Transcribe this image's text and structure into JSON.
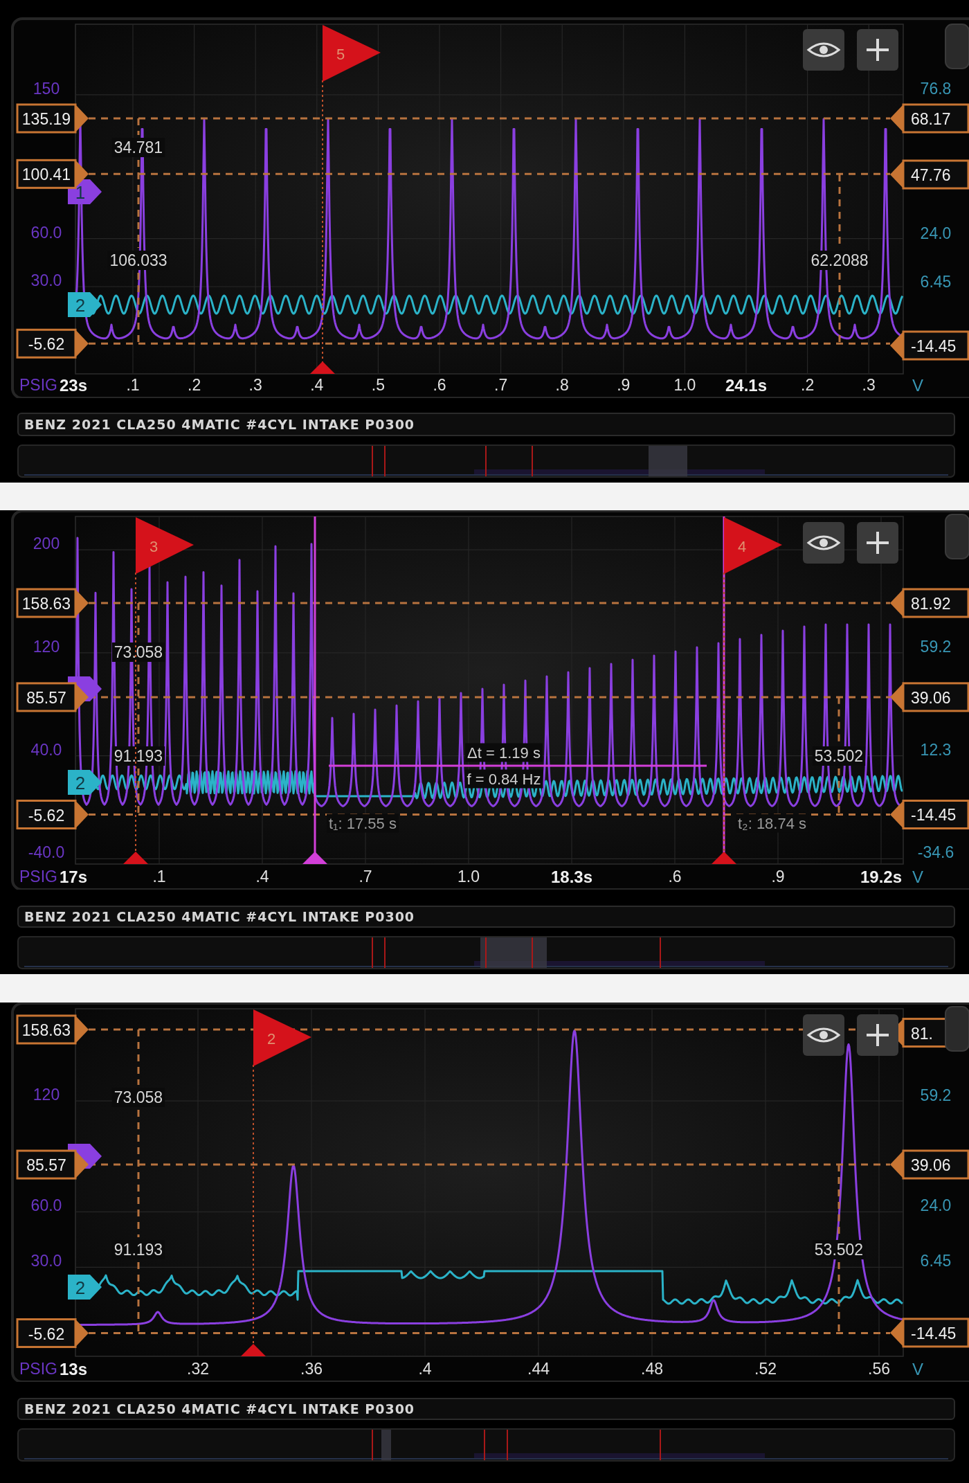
{
  "panels": [
    {
      "left_ticks": [
        "150",
        "60.0",
        "30.0"
      ],
      "right_ticks": [
        "76.8",
        "24.0",
        "6.45"
      ],
      "left_cursors": [
        "135.19",
        "100.41",
        "-5.62"
      ],
      "right_cursors": [
        "68.17",
        "47.76",
        "-14.45"
      ],
      "channel_markers": [
        {
          "label": "1",
          "color": "#8a3fe0"
        },
        {
          "label": "2",
          "color": "#2bb3c8"
        }
      ],
      "flags": [
        {
          "label": "5"
        }
      ],
      "readouts": [
        "34.781",
        "106.033",
        "62.2088"
      ],
      "x_axis": {
        "quantity": "PSIG",
        "start": "23s",
        "ticks": [
          {
            "label": ".1",
            "kind": "minor"
          },
          {
            "label": ".2",
            "kind": "minor"
          },
          {
            "label": ".3",
            "kind": "minor"
          },
          {
            "label": ".4",
            "kind": "minor"
          },
          {
            "label": ".5",
            "kind": "minor"
          },
          {
            "label": ".6",
            "kind": "minor"
          },
          {
            "label": ".7",
            "kind": "minor"
          },
          {
            "label": ".8",
            "kind": "minor"
          },
          {
            "label": ".9",
            "kind": "minor"
          },
          {
            "label": "1.0",
            "kind": "minor"
          },
          {
            "label": "24.1s",
            "kind": "major"
          },
          {
            "label": ".2",
            "kind": "minor"
          },
          {
            "label": ".3",
            "kind": "minor"
          }
        ],
        "unit": "V"
      },
      "title": "BENZ 2021 CLA250 4MATIC #4CYL INTAKE P0300"
    },
    {
      "left_ticks": [
        "200",
        "120",
        "40.0",
        "-40.0"
      ],
      "right_ticks": [
        "59.2",
        "12.3",
        "-34.6"
      ],
      "left_cursors": [
        "158.63",
        "85.57",
        "-5.62"
      ],
      "right_cursors": [
        "81.92",
        "39.06",
        "-14.45"
      ],
      "channel_markers": [
        {
          "color": "#8a3fe0"
        },
        {
          "label": "2",
          "color": "#2bb3c8"
        }
      ],
      "flags": [
        {
          "label": "3"
        },
        {
          "label": "4"
        }
      ],
      "readouts": [
        "73.058",
        "91.193",
        "53.502"
      ],
      "measurement": {
        "delta": "Δt = 1.19 s",
        "frequency": "f = 0.84 Hz",
        "t1": "t₁: 17.55 s",
        "t2": "t₂: 18.74 s"
      },
      "x_axis": {
        "quantity": "PSIG",
        "start": "17s",
        "ticks": [
          {
            "label": ".1",
            "kind": "minor"
          },
          {
            "label": ".4",
            "kind": "minor"
          },
          {
            "label": ".7",
            "kind": "minor"
          },
          {
            "label": "1.0",
            "kind": "minor"
          },
          {
            "label": "18.3s",
            "kind": "major"
          },
          {
            "label": ".6",
            "kind": "minor"
          },
          {
            "label": ".9",
            "kind": "minor"
          },
          {
            "label": "19.2s",
            "kind": "major"
          }
        ],
        "unit": "V"
      },
      "title": "BENZ 2021 CLA250 4MATIC #4CYL INTAKE P0300"
    },
    {
      "left_ticks": [
        "120",
        "60.0",
        "30.0"
      ],
      "right_ticks": [
        "59.2",
        "24.0",
        "6.45"
      ],
      "left_cursors": [
        "158.63",
        "85.57",
        "-5.62"
      ],
      "right_cursors": [
        "81.",
        "39.06",
        "-14.45"
      ],
      "channel_markers": [
        {
          "color": "#8a3fe0"
        },
        {
          "label": "2",
          "color": "#2bb3c8"
        }
      ],
      "flags": [
        {
          "label": "2"
        }
      ],
      "readouts": [
        "73.058",
        "91.193",
        "53.502"
      ],
      "x_axis": {
        "quantity": "PSIG",
        "start": "13s",
        "ticks": [
          {
            "label": ".32",
            "kind": "minor"
          },
          {
            "label": ".36",
            "kind": "minor"
          },
          {
            "label": ".4",
            "kind": "minor"
          },
          {
            "label": ".44",
            "kind": "minor"
          },
          {
            "label": ".48",
            "kind": "minor"
          },
          {
            "label": ".52",
            "kind": "minor"
          },
          {
            "label": ".56",
            "kind": "minor"
          }
        ],
        "unit": "V"
      },
      "title": "BENZ 2021 CLA250 4MATIC #4CYL INTAKE P0300"
    }
  ]
}
